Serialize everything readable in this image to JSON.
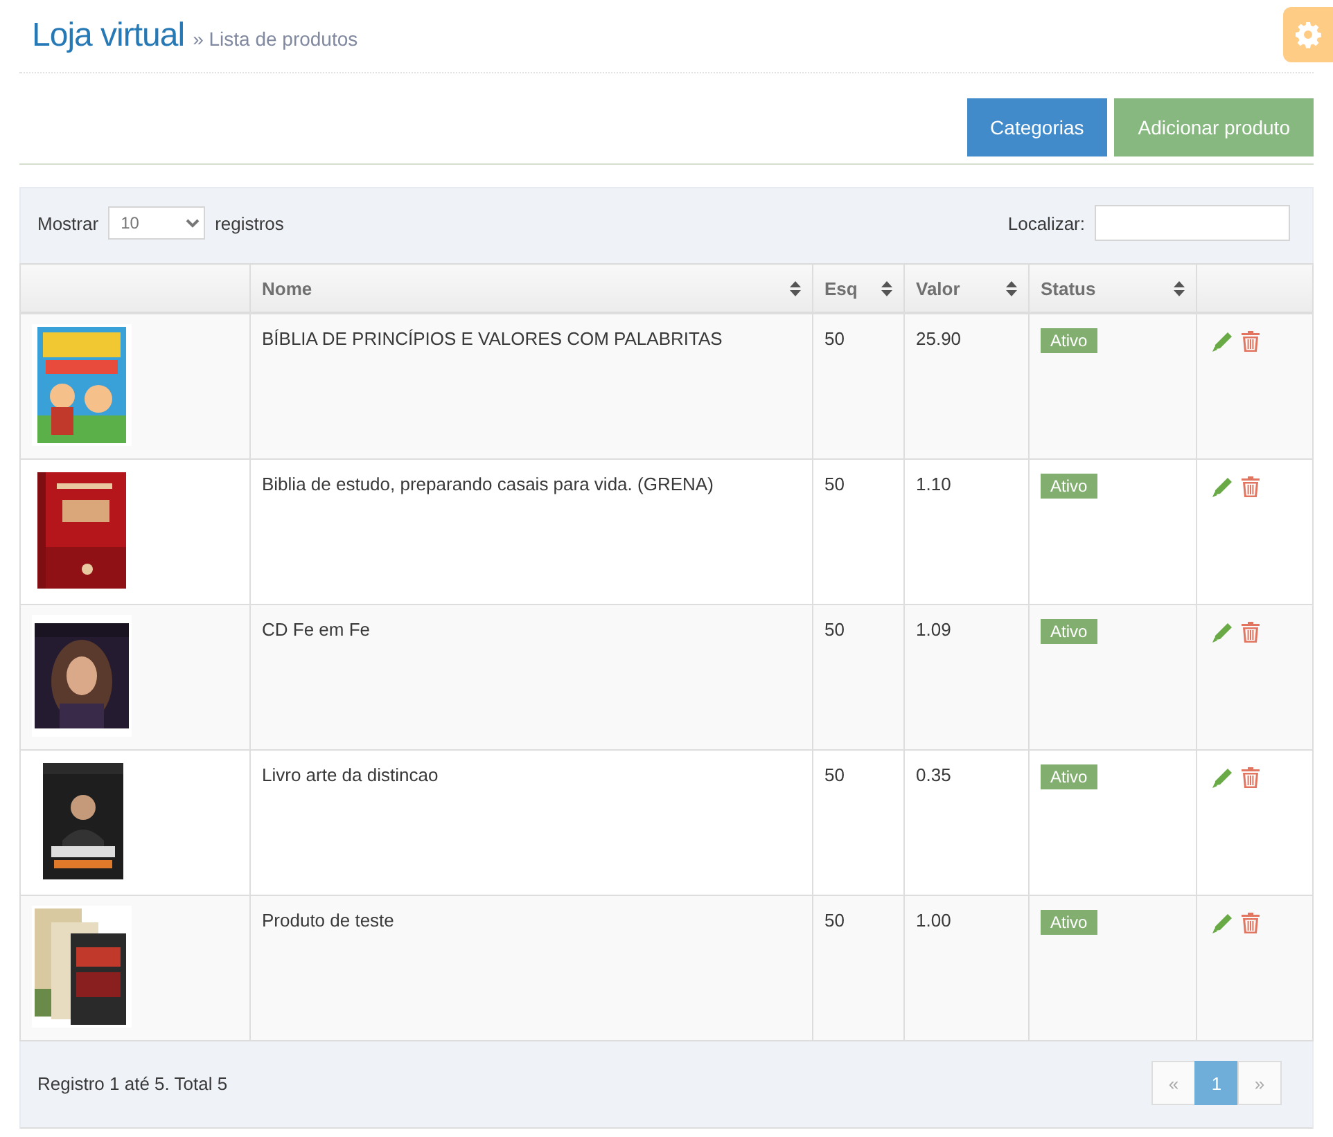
{
  "header": {
    "title": "Loja virtual",
    "breadcrumb": "» Lista de produtos"
  },
  "toolbar": {
    "buttons": [
      {
        "label": "Categorias",
        "kind": "primary"
      },
      {
        "label": "Adicionar produto",
        "kind": "success"
      }
    ]
  },
  "table_controls": {
    "show_label": "Mostrar",
    "page_size": "10",
    "records_label": "registros",
    "search_label": "Localizar:"
  },
  "table": {
    "columns": [
      {
        "label": "Nome",
        "sortable": true
      },
      {
        "label": "Esq",
        "sortable": true
      },
      {
        "label": "Valor",
        "sortable": true
      },
      {
        "label": "Status",
        "sortable": true
      }
    ],
    "rows": [
      {
        "name": "BÍBLIA DE PRINCÍPIOS E VALORES COM PALABRITAS",
        "stock": "50",
        "price": "25.90",
        "status": {
          "label": "Ativo",
          "active": true
        }
      },
      {
        "name": "Biblia de estudo, preparando casais para vida. (GRENA)",
        "stock": "50",
        "price": "1.10",
        "status": {
          "label": "Ativo",
          "active": true
        }
      },
      {
        "name": "CD Fe em Fe",
        "stock": "50",
        "price": "1.09",
        "status": {
          "label": "Ativo",
          "active": true
        }
      },
      {
        "name": "Livro arte da distincao",
        "stock": "50",
        "price": "0.35",
        "status": {
          "label": "Ativo",
          "active": true
        }
      },
      {
        "name": "Produto de teste",
        "stock": "50",
        "price": "1.00",
        "status": {
          "label": "Ativo",
          "active": true
        }
      }
    ]
  },
  "footer": {
    "info": "Registro 1 até 5. Total 5",
    "pagination": [
      {
        "label": "«",
        "selected": false,
        "disabled": true
      },
      {
        "label": "1",
        "selected": true,
        "disabled": false
      },
      {
        "label": "»",
        "selected": false,
        "disabled": true
      }
    ]
  }
}
